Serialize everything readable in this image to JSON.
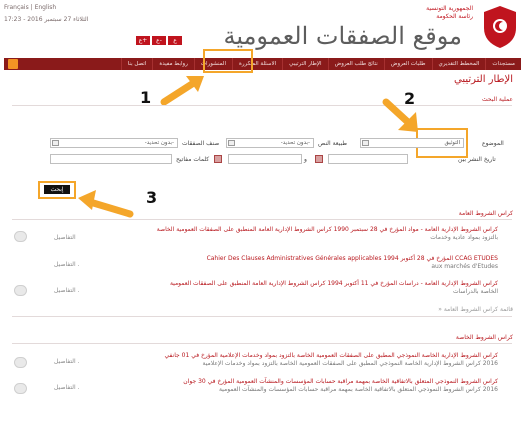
{
  "header": {
    "lang": "Français | English",
    "dateline": "الثلاثاء 27 سبتمبر 2016 - 17:23",
    "font_buttons": [
      "ع+",
      "ع-",
      "ع"
    ],
    "site_title": "موقع الصفقات العمومية",
    "ministry_line1": "الجمهورية التونسية",
    "ministry_line2": "رئاسة الحكومة"
  },
  "nav": {
    "items": [
      "مستجدات",
      "المخطط التقديري",
      "طلبات العروض",
      "نتائج طلب العروض",
      "الإطار الترتيبي",
      "الاسئلة المتكررة",
      "المنشورات",
      "روابط مفيدة",
      "اتصل بنا"
    ]
  },
  "annotations": {
    "n1": "1",
    "n2": "2",
    "n3": "3"
  },
  "page": {
    "title": "الإطار الترتيبي",
    "search_section": "عملية البحث"
  },
  "form": {
    "subject_label": "الموضوع",
    "subject_value": "التوثيق",
    "text_type_label": "طبيعة النص",
    "select_placeholder": "-بدون تحديد-",
    "category_label": "صنف الصفقات",
    "date_label": "تاريخ النشر بين",
    "and_label": "و",
    "keywords_label": "كلمات مفاتيح",
    "search_button": "إبحث"
  },
  "sections": {
    "general_title": "كراس الشروط العامة",
    "all_general": "» قائمة كراس الشروط العامة",
    "special_title": "كراس الشروط الخاصة",
    "detail_label": "التفاصيل",
    "detail_label_dot": "التفاصيل ."
  },
  "results_general": [
    {
      "text": "كراس الشروط الإدارية العامة - مواد المؤرخ في 28 سبتمبر 1990 كراس الشروط الإدارية العامة المنطبق على الصفقات العمومية الخاصة",
      "sub": "بالتزود بمواد عادية وخدمات"
    },
    {
      "text": "CCAG ETUDES المؤرخ في 28 أكتوبر 1994 Cahier Des Clauses Administratives Générales applicables",
      "sub": "aux marchés d'Etudes"
    },
    {
      "text": "كراس الشروط الإدارية العامة - دراسات المؤرخ في 11 أكتوبر 1994 كراس الشروط الإدارية العامة المنطبق على الصفقات العمومية",
      "sub": "الخاصة بالدراسات"
    }
  ],
  "results_special": [
    {
      "text": "كراس الشروط الإدارية الخاصة النموذجي المطبق على الصفقات العمومية الخاصة بالتزود بمواد وخدمات الإعلامية المؤرخ في 01 جانفي",
      "sub": "2016 كراس الشروط الإدارية الخاصة النموذجي المطبق على الصفقات العمومية الخاصة بالتزود بمواد وخدمات الإعلامية"
    },
    {
      "text": "كراس الشروط النموذجي المتعلق بالاتفاقية الخاصة بمهمة مراقبة حسابات المؤسسات والمنشآت العمومية المؤرخ في 30 جوان",
      "sub": "2016 كراس الشروط النموذجي المتعلق بالاتفاقية الخاصة بمهمة مراقبة حسابات المؤسسات والمنشآت العمومية"
    }
  ],
  "colors": {
    "brand_red": "#b8181e",
    "nav_bg": "#8a1a1a",
    "highlight": "#f4a62a"
  }
}
